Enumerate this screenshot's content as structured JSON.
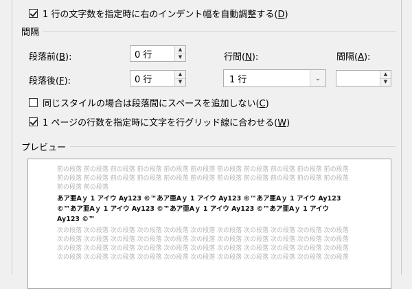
{
  "options": {
    "auto_indent": {
      "text": "1 行の文字数を指定時に右のインデント幅を自動調整する(",
      "key": "D",
      "close": ")",
      "checked": true
    }
  },
  "spacing": {
    "title": "間隔",
    "before": {
      "label": "段落前(",
      "key": "B",
      "close": "):",
      "value": "0 行"
    },
    "after": {
      "label": "段落後(",
      "key": "F",
      "close": "):",
      "value": "0 行"
    },
    "line_spacing": {
      "label": "行間(",
      "key": "N",
      "close": "):",
      "value": "1 行"
    },
    "at": {
      "label": "間隔(",
      "key": "A",
      "close": "):",
      "value": ""
    },
    "no_space_same_style": {
      "text": "同じスタイルの場合は段落間にスペースを追加しない(",
      "key": "C",
      "close": ")",
      "checked": false
    },
    "snap_to_grid": {
      "text": "1 ページの行数を指定時に文字を行グリッド線に合わせる(",
      "key": "W",
      "close": ")",
      "checked": true
    }
  },
  "preview": {
    "title": "プレビュー",
    "prev_lines": [
      "前の段落 前の段落 前の段落 前の段落 前の段落 前の段落 前の段落 前の段落 前の段落 前の段落 前の段落",
      "前の段落 前の段落 前の段落 前の段落 前の段落 前の段落 前の段落 前の段落 前の段落 前の段落 前の段落",
      "前の段落 前の段落"
    ],
    "sample_lines": [
      "あア亜Aｙ 1 アイウ Ay123 ©™あア亜Aｙ 1 アイウ Ay123 ©™あア亜Aｙ 1 アイウ Ay123",
      "©™あア亜Aｙ 1 アイウ Ay123 ©™あア亜Aｙ 1 アイウ Ay123 ©™あア亜Aｙ 1 アイウ",
      "Ay123 ©™"
    ],
    "next_lines": [
      "次の段落 次の段落 次の段落 次の段落 次の段落 次の段落 次の段落 次の段落 次の段落 次の段落 次の段落",
      "次の段落 次の段落 次の段落 次の段落 次の段落 次の段落 次の段落 次の段落 次の段落 次の段落 次の段落",
      "次の段落 次の段落 次の段落 次の段落 次の段落 次の段落 次の段落 次の段落 次の段落 次の段落 次の段落",
      "次の段落 次の段落 次の段落 次の段落 次の段落 次の段落 次の段落 次の段落 次の段落 次の段落 次の段落"
    ]
  },
  "icons": {
    "spin_up": "▲",
    "spin_down": "▼",
    "dropdown": "⌄"
  }
}
